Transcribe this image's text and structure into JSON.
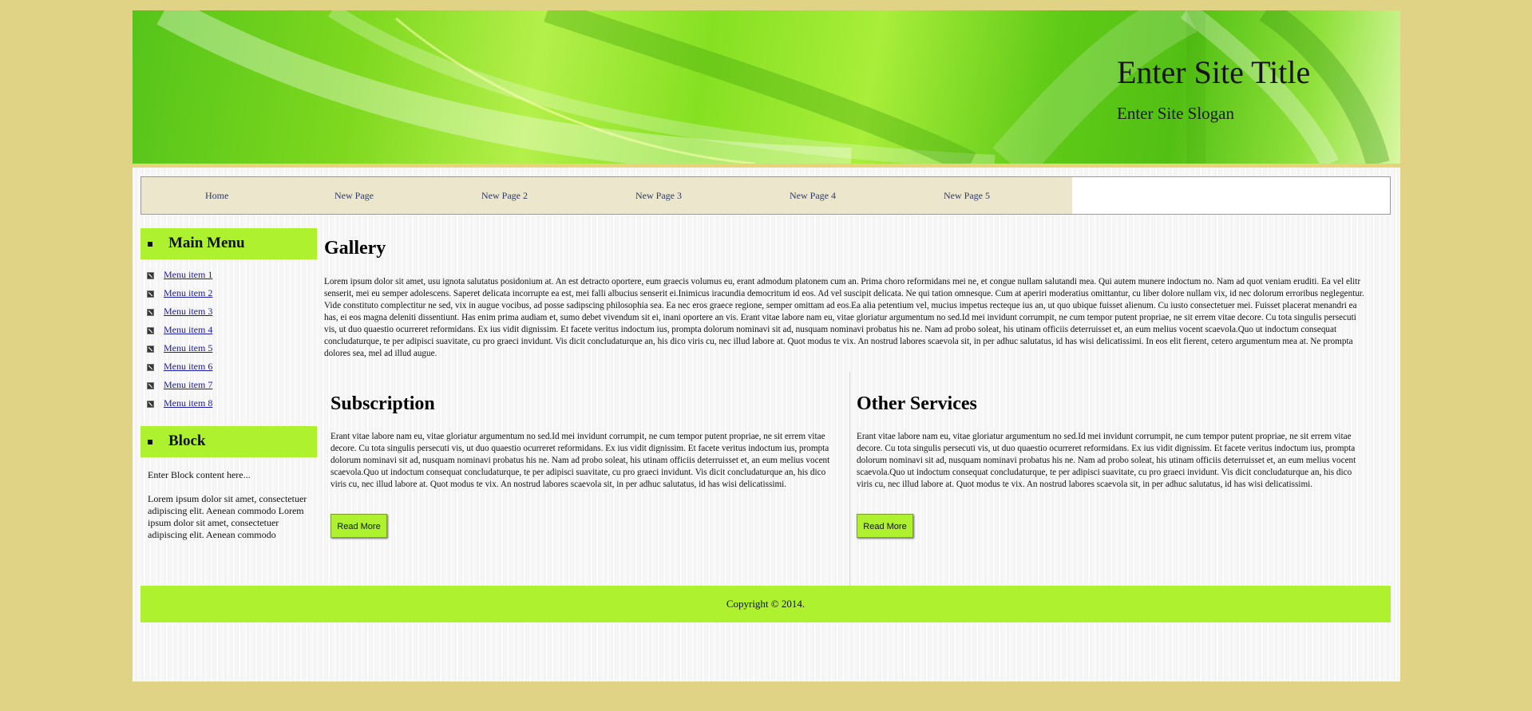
{
  "header": {
    "site_title": "Enter Site Title",
    "site_slogan": "Enter Site Slogan"
  },
  "nav": {
    "items": [
      {
        "label": "Home"
      },
      {
        "label": "New Page"
      },
      {
        "label": "New Page 2"
      },
      {
        "label": "New Page 3"
      },
      {
        "label": "New Page 4"
      },
      {
        "label": "New Page 5"
      }
    ]
  },
  "sidebar": {
    "main_menu": {
      "title": "Main Menu",
      "items": [
        {
          "label": "Menu item 1"
        },
        {
          "label": "Menu item 2"
        },
        {
          "label": "Menu item 3"
        },
        {
          "label": "Menu item 4"
        },
        {
          "label": "Menu item 5"
        },
        {
          "label": "Menu item 6"
        },
        {
          "label": "Menu item 7"
        },
        {
          "label": "Menu item 8"
        }
      ]
    },
    "block": {
      "title": "Block",
      "intro": "Enter Block content here...",
      "body": "Lorem ipsum dolor sit amet, consectetuer adipiscing elit. Aenean commodo Lorem ipsum dolor sit amet, consectetuer adipiscing elit. Aenean commodo"
    }
  },
  "main": {
    "gallery": {
      "title": "Gallery",
      "text": "Lorem ipsum dolor sit amet, usu ignota salutatus posidonium at. An est detracto oportere, eum graecis volumus eu, erant admodum platonem cum an. Prima choro reformidans mei ne, et congue nullam salutandi mea. Qui autem munere indoctum no. Nam ad quot veniam eruditi. Ea vel elitr senserit, mei eu semper adolescens. Saperet delicata incorrupte ea est, mei falli albucius senserit ei.Inimicus iracundia democritum id eos. Ad vel suscipit delicata. Ne qui tation omnesque. Cum at aperiri moderatius omittantur, cu liber dolore nullam vix, id nec dolorum erroribus neglegentur. Vide constituto complectitur ne sed, vix in augue vocibus, ad posse sadipscing philosophia sea. Ea nec eros graece regione, semper omittam ad eos.Ea alia petentium vel, mucius impetus recteque ius an, ut quo ubique fuisset alienum. Cu iusto consectetuer mei. Fuisset placerat menandri ea has, ei eos magna deleniti dissentiunt. Has enim prima audiam et, sumo debet vivendum sit ei, inani oportere an vis. Erant vitae labore nam eu, vitae gloriatur argumentum no sed.Id mei invidunt corrumpit, ne cum tempor putent propriae, ne sit errem vitae decore. Cu tota singulis persecuti vis, ut duo quaestio ocurreret reformidans. Ex ius vidit dignissim. Et facete veritus indoctum ius, prompta dolorum nominavi sit ad, nusquam nominavi probatus his ne. Nam ad probo soleat, his utinam officiis deterruisset et, an eum melius vocent scaevola.Quo ut indoctum consequat concludaturque, te per adipisci suavitate, cu pro graeci invidunt. Vis dicit concludaturque an, his dico viris cu, nec illud labore at. Quot modus te vix. An nostrud labores scaevola sit, in per adhuc salutatus, id has wisi delicatissimi. In eos elit fierent, cetero argumentum mea at. Ne prompta dolores sea, mel ad illud augue."
    },
    "subscription": {
      "title": "Subscription",
      "text": "Erant vitae labore nam eu, vitae gloriatur argumentum no sed.Id mei invidunt corrumpit, ne cum tempor putent propriae, ne sit errem vitae decore. Cu tota singulis persecuti vis, ut duo quaestio ocurreret reformidans. Ex ius vidit dignissim. Et facete veritus indoctum ius, prompta dolorum nominavi sit ad, nusquam nominavi probatus his ne. Nam ad probo soleat, his utinam officiis deterruisset et, an eum melius vocent scaevola.Quo ut indoctum consequat concludaturque, te per adipisci suavitate, cu pro graeci invidunt. Vis dicit concludaturque an, his dico viris cu, nec illud labore at. Quot modus te vix. An nostrud labores scaevola sit, in per adhuc salutatus, id has wisi delicatissimi.",
      "button": "Read More"
    },
    "other_services": {
      "title": "Other Services",
      "text": "Erant vitae labore nam eu, vitae gloriatur argumentum no sed.Id mei invidunt corrumpit, ne cum tempor putent propriae, ne sit errem vitae decore. Cu tota singulis persecuti vis, ut duo quaestio ocurreret reformidans. Ex ius vidit dignissim. Et facete veritus indoctum ius, prompta dolorum nominavi sit ad, nusquam nominavi probatus his ne. Nam ad probo soleat, his utinam officiis deterruisset et, an eum melius vocent scaevola.Quo ut indoctum consequat concludaturque, te per adipisci suavitate, cu pro graeci invidunt. Vis dicit concludaturque an, his dico viris cu, nec illud labore at. Quot modus te vix. An nostrud labores scaevola sit, in per adhuc salutatus, id has wisi delicatissimi.",
      "button": "Read More"
    }
  },
  "footer": {
    "copyright": "Copyright © 2014."
  },
  "colors": {
    "page_bg": "#e0d385",
    "accent_green": "#adf12f",
    "nav_bg": "#ebe6cc"
  }
}
